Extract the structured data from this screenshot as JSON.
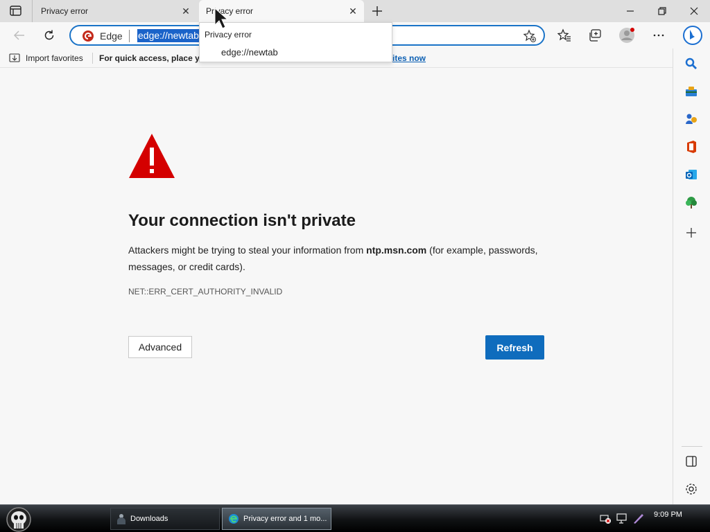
{
  "browser": {
    "tabs": [
      {
        "title": "Privacy error",
        "close": "✕"
      },
      {
        "title": "Privacy error",
        "close": "✕"
      }
    ],
    "new_tab_symbol": "+",
    "window_controls": {
      "minimize": "minimize-icon",
      "restore": "restore-icon",
      "close": "close-icon"
    }
  },
  "tab_dropdown": {
    "title": "Privacy error",
    "url": "edge://newtab"
  },
  "addressbar": {
    "brand": "Edge",
    "url": "edge://newtab"
  },
  "favorites_bar": {
    "import_label": "Import favorites",
    "hint_text": "For quick access, place you",
    "link_text": "ites now"
  },
  "error_page": {
    "title": "Your connection isn't private",
    "body_prefix": "Attackers might be trying to steal your information from ",
    "host": "ntp.msn.com",
    "body_suffix": " (for example, passwords, messages, or credit cards).",
    "error_code": "NET::ERR_CERT_AUTHORITY_INVALID",
    "advanced_label": "Advanced",
    "refresh_label": "Refresh"
  },
  "sidebar": {
    "items": [
      "search-icon",
      "tools-icon",
      "games-icon",
      "office-icon",
      "outlook-icon",
      "tree-icon",
      "add-icon",
      "split-screen-icon",
      "settings-icon"
    ]
  },
  "taskbar": {
    "items": [
      {
        "label": "Downloads"
      },
      {
        "label": "Privacy error and 1 mo..."
      }
    ],
    "clock": "9:09 PM"
  },
  "colors": {
    "accent": "#0f6cbd",
    "warning": "#d40000",
    "selection": "#1a63c9"
  }
}
